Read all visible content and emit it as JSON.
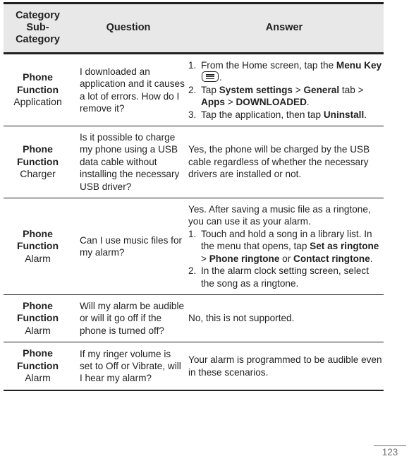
{
  "document": {
    "page_number": "123"
  },
  "table": {
    "headers": {
      "category": "Category",
      "category_line2": "Sub-",
      "category_line3": "Category",
      "question": "Question",
      "answer": "Answer"
    },
    "rows": [
      {
        "category_main_line1": "Phone",
        "category_main_line2": "Function",
        "category_sub": "Application",
        "question": "I downloaded an application and it causes a lot of errors. How do I remove it?",
        "answer_intro": "",
        "steps": [
          {
            "num": "1.",
            "parts": [
              {
                "text": "From the Home screen, tap the ",
                "style": "normal"
              },
              {
                "text": "Menu Key",
                "style": "bold"
              },
              {
                "text": " ",
                "style": "normal"
              },
              {
                "text": "menu-key-icon",
                "style": "icon"
              },
              {
                "text": ".",
                "style": "normal"
              }
            ]
          },
          {
            "num": "2.",
            "parts": [
              {
                "text": "Tap ",
                "style": "normal"
              },
              {
                "text": "System settings",
                "style": "bold"
              },
              {
                "text": " > ",
                "style": "normal"
              },
              {
                "text": "General",
                "style": "bold"
              },
              {
                "text": " tab > ",
                "style": "normal"
              },
              {
                "text": "Apps",
                "style": "bold"
              },
              {
                "text": " > ",
                "style": "normal"
              },
              {
                "text": "DOWNLOADED",
                "style": "bold"
              },
              {
                "text": ".",
                "style": "normal"
              }
            ]
          },
          {
            "num": "3.",
            "parts": [
              {
                "text": "Tap the application, then tap ",
                "style": "normal"
              },
              {
                "text": "Uninstall",
                "style": "bold"
              },
              {
                "text": ".",
                "style": "normal"
              }
            ]
          }
        ]
      },
      {
        "category_main_line1": "Phone",
        "category_main_line2": "Function",
        "category_sub": "Charger",
        "question": "Is it possible to charge my phone using a USB data cable without installing the necessary USB driver?",
        "answer_intro": "Yes, the phone will be charged by the USB cable regardless of whether the necessary drivers are installed or not.",
        "steps": []
      },
      {
        "category_main_line1": "Phone",
        "category_main_line2": "Function",
        "category_sub": "Alarm",
        "question": "Can I use music files for my alarm?",
        "answer_intro": "Yes. After saving a music file as a ringtone, you can use it as your alarm.",
        "steps": [
          {
            "num": "1.",
            "parts": [
              {
                "text": "Touch and hold a song in a library list. In the menu that opens, tap ",
                "style": "normal"
              },
              {
                "text": "Set as ringtone",
                "style": "bold"
              },
              {
                "text": " > ",
                "style": "normal"
              },
              {
                "text": "Phone ringtone",
                "style": "bold"
              },
              {
                "text": " or ",
                "style": "normal"
              },
              {
                "text": "Contact ringtone",
                "style": "bold"
              },
              {
                "text": ".",
                "style": "normal"
              }
            ]
          },
          {
            "num": "2.",
            "parts": [
              {
                "text": "In the alarm clock setting screen, select the song as a ringtone.",
                "style": "normal"
              }
            ]
          }
        ]
      },
      {
        "category_main_line1": "Phone",
        "category_main_line2": "Function",
        "category_sub": "Alarm",
        "question": "Will my alarm be audible or will it go off if the phone is turned off?",
        "answer_intro": "No, this is not supported.",
        "steps": []
      },
      {
        "category_main_line1": "Phone",
        "category_main_line2": "Function",
        "category_sub": "Alarm",
        "question": "If my ringer volume is set to Off or Vibrate, will I hear my alarm?",
        "answer_intro": "Your alarm is programmed to be audible even in these scenarios.",
        "steps": []
      }
    ]
  },
  "colors": {
    "header_background": "#e8e8e8",
    "text": "#221f1f",
    "rule": "#221f1f",
    "page_number": "#6d6e71"
  }
}
